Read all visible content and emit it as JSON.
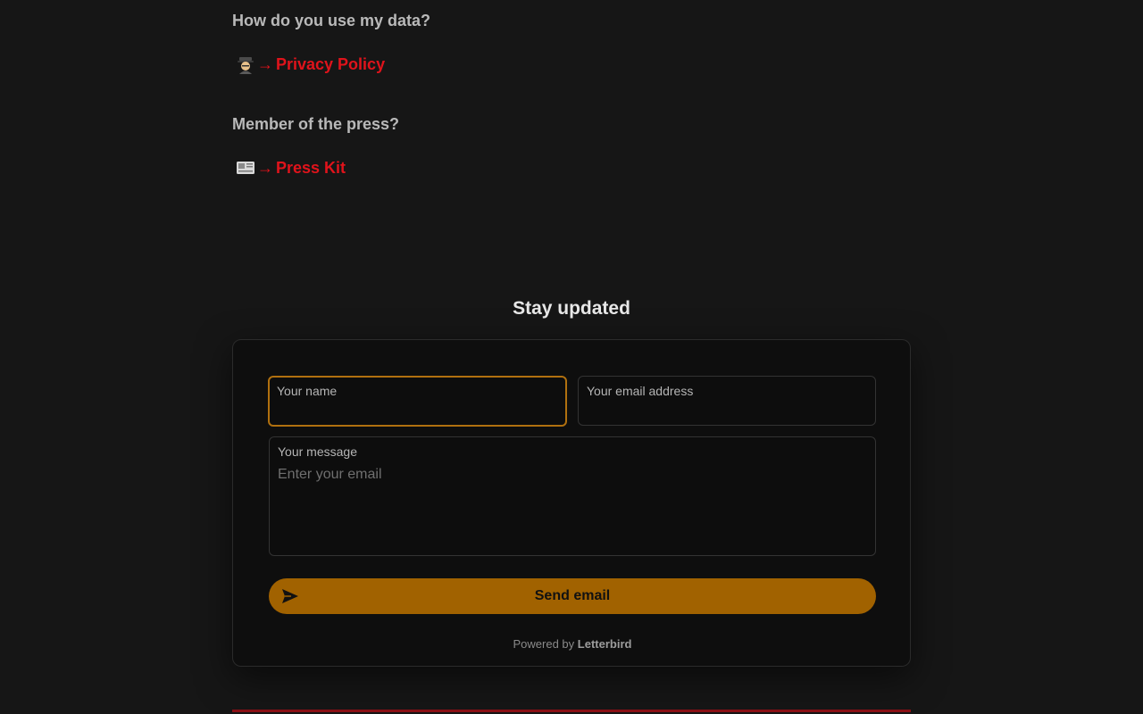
{
  "faq": {
    "data_question": "How do you use my data?",
    "privacy_link": "Privacy Policy",
    "press_question": "Member of the press?",
    "press_link": "Press Kit",
    "arrow": "→"
  },
  "newsletter": {
    "title": "Stay updated",
    "name_label": "Your name",
    "email_label": "Your email address",
    "message_label": "Your message",
    "message_placeholder": "Enter your email",
    "send_label": "Send email",
    "powered_prefix": "Powered by",
    "powered_brand": "Letterbird"
  },
  "colors": {
    "background": "#161616",
    "link_red": "#e0131b",
    "button_amber": "#a16200",
    "focus_border": "#b0700f"
  },
  "icons": [
    "detective-emoji-icon",
    "newspaper-emoji-icon",
    "send-icon"
  ]
}
